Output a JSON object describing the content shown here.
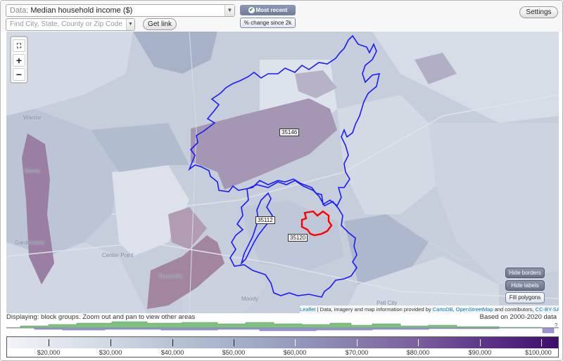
{
  "toolbar": {
    "data_prefix": "Data: ",
    "data_value": "Median household income ($)",
    "find_placeholder": "Find City, State, County or Zip Code",
    "get_link": "Get link",
    "mode_recent": "Most recent value",
    "mode_change": "% change since 2k",
    "settings": "Settings"
  },
  "map": {
    "zip_labels": [
      "35146",
      "35112",
      "35120"
    ],
    "place_labels": [
      "Warrior",
      "Morris",
      "Gardendale",
      "Center Point",
      "Trussville",
      "Moody",
      "Pell City"
    ],
    "buttons": {
      "hide_borders": "Hide borders",
      "hide_labels": "Hide labels",
      "fill_polygons": "Fill polygons"
    },
    "attribution": {
      "leaflet": "Leaflet",
      "text1": " | Data, imagery and map information provided by ",
      "cartodb": "CartoDB",
      "text2": ", ",
      "osm": "OpenStreetMap",
      "text3": " and contributors, ",
      "license": "CC-BY-SA"
    },
    "colors": {
      "selected_border": "#ff0000",
      "zip_border": "#1a1aff"
    }
  },
  "footer": {
    "displaying": "Displaying: block groups. Zoom out and pan to view other areas",
    "based_on": "Based on 2000-2020 data",
    "question": "?",
    "legend_labels": [
      "$20,000",
      "$30,000",
      "$40,000",
      "$50,000",
      "$60,000",
      "$70,000",
      "$80,000",
      "$90,000",
      "$100,000"
    ]
  }
}
